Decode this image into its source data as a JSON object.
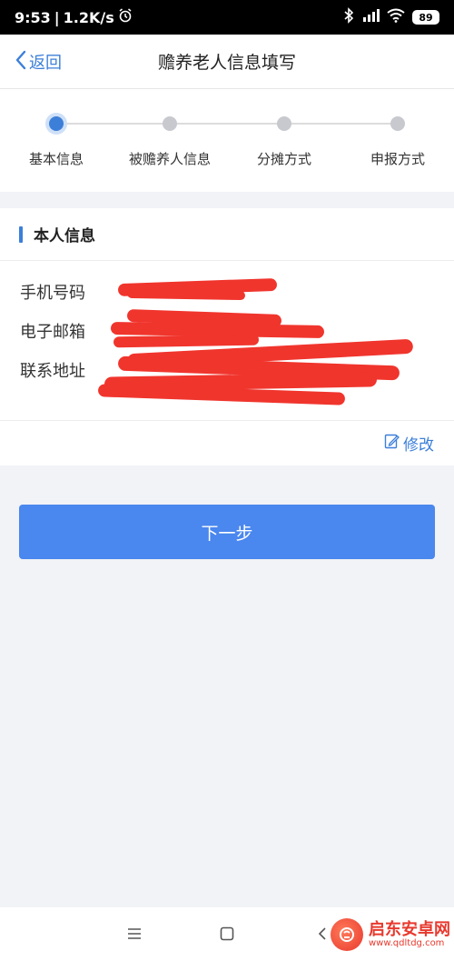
{
  "status_bar": {
    "time": "9:53",
    "speed": "1.2K/s",
    "battery": "89"
  },
  "header": {
    "back_label": "返回",
    "title": "赡养老人信息填写"
  },
  "stepper": {
    "steps": [
      {
        "label": "基本信息",
        "active": true
      },
      {
        "label": "被赡养人信息",
        "active": false
      },
      {
        "label": "分摊方式",
        "active": false
      },
      {
        "label": "申报方式",
        "active": false
      }
    ]
  },
  "info": {
    "section_title": "本人信息",
    "fields": [
      {
        "label": "手机号码"
      },
      {
        "label": "电子邮箱"
      },
      {
        "label": "联系地址"
      }
    ],
    "edit_label": "修改"
  },
  "next_button": "下一步",
  "watermark": {
    "name": "启东安卓网",
    "url": "www.qdltdg.com"
  },
  "colors": {
    "accent": "#3c7fd9",
    "button": "#4a87ee",
    "redaction": "#f0352d"
  }
}
